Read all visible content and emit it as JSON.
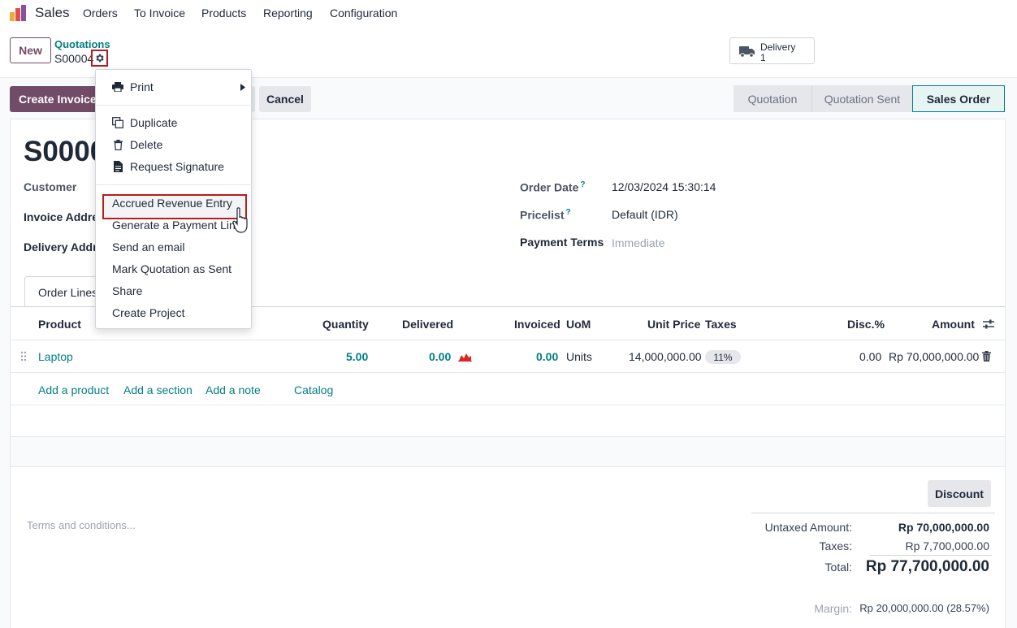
{
  "app": {
    "name": "Sales",
    "accent": "#714b67",
    "link_color": "#017e84"
  },
  "nav": [
    "Orders",
    "To Invoice",
    "Products",
    "Reporting",
    "Configuration"
  ],
  "control": {
    "new_label": "New",
    "breadcrumb_parent": "Quotations",
    "breadcrumb_current": "S00004",
    "delivery_label": "Delivery",
    "delivery_count": "1"
  },
  "actions": {
    "create_invoice": "Create Invoice",
    "cancel": "Cancel"
  },
  "statusbar": [
    "Quotation",
    "Quotation Sent",
    "Sales Order"
  ],
  "statusbar_active": "Sales Order",
  "record": {
    "name": "S0000",
    "fields_left": [
      "Customer",
      "Invoice Addre",
      "Delivery Addr"
    ],
    "order_date_label": "Order Date",
    "order_date": "12/03/2024 15:30:14",
    "pricelist_label": "Pricelist",
    "pricelist": "Default (IDR)",
    "payment_terms_label": "Payment Terms",
    "payment_terms": "Immediate",
    "help_mark": "?"
  },
  "tab_label": "Order Lines",
  "table": {
    "headers": [
      "Product",
      "Quantity",
      "Delivered",
      "Invoiced",
      "UoM",
      "Unit Price",
      "Taxes",
      "Disc.%",
      "Amount"
    ],
    "row": {
      "product": "Laptop",
      "quantity": "5.00",
      "delivered": "0.00",
      "invoiced": "0.00",
      "uom": "Units",
      "unit_price": "14,000,000.00",
      "taxes": "11%",
      "discount": "0.00",
      "amount": "Rp 70,000,000.00"
    },
    "add_links": [
      "Add a product",
      "Add a section",
      "Add a note",
      "Catalog"
    ]
  },
  "terms_placeholder": "Terms and conditions...",
  "discount_button": "Discount",
  "totals": {
    "untaxed_label": "Untaxed Amount:",
    "untaxed": "Rp 70,000,000.00",
    "taxes_label": "Taxes:",
    "taxes": "Rp 7,700,000.00",
    "total_label": "Total:",
    "total": "Rp 77,700,000.00",
    "margin_label": "Margin:",
    "margin": "Rp 20,000,000.00 (28.57%)"
  },
  "dropdown": {
    "print": "Print",
    "duplicate": "Duplicate",
    "delete": "Delete",
    "request_signature": "Request Signature",
    "accrued_revenue": "Accrued Revenue Entry",
    "generate_payment_link": "Generate a Payment Link",
    "send_email": "Send an email",
    "mark_sent": "Mark Quotation as Sent",
    "share": "Share",
    "create_project": "Create Project"
  }
}
